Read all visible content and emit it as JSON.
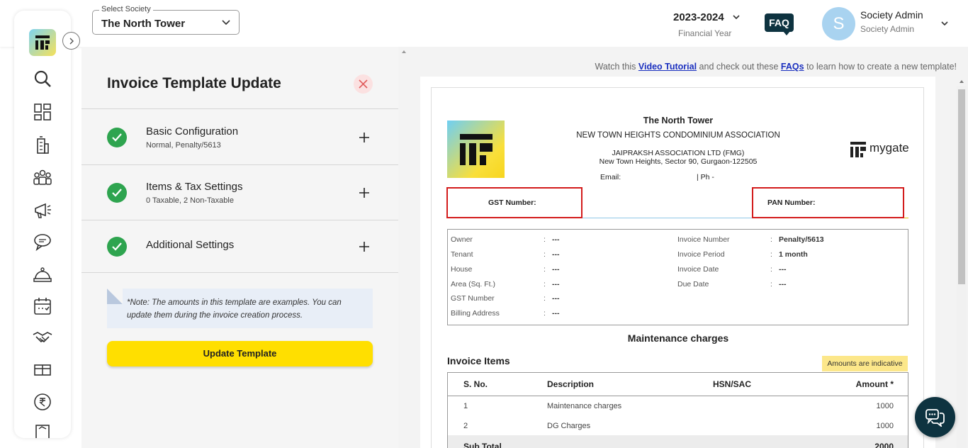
{
  "header": {
    "society_select_label": "Select Society",
    "society_select_value": "The North Tower",
    "financial_year": "2023-2024",
    "financial_year_label": "Financial Year",
    "faq_label": "FAQ",
    "avatar_initial": "S",
    "user_name": "Society Admin",
    "user_role": "Society Admin"
  },
  "sidebar": {
    "icons": [
      "mygate-logo-icon",
      "search-icon",
      "dashboard-icon",
      "building-icon",
      "residents-icon",
      "announcement-icon",
      "chat-icon",
      "helpdesk-icon",
      "calendar-icon",
      "handshake-icon",
      "amenities-icon",
      "rupee-icon"
    ]
  },
  "panel": {
    "title": "Invoice Template Update",
    "sections": [
      {
        "title": "Basic Configuration",
        "subtitle": "Normal, Penalty/5613"
      },
      {
        "title": "Items & Tax Settings",
        "subtitle": "0 Taxable, 2 Non-Taxable"
      },
      {
        "title": "Additional Settings",
        "subtitle": ""
      }
    ],
    "note": "*Note: The amounts in this template are examples. You can update them during the invoice creation process.",
    "update_button": "Update Template"
  },
  "tutorial": {
    "prefix": "Watch this",
    "video_link": "Video Tutorial",
    "middle": "and check out these",
    "faq_link": "FAQs",
    "suffix": "to learn how to create a new template!"
  },
  "invoice": {
    "society_name": "The North Tower",
    "association": "NEW TOWN HEIGHTS CONDOMINIUM ASSOCIATION",
    "address_line1": "JAIPRAKSH ASSOCIATION LTD (FMG)",
    "address_line2": "New Town Heights, Sector 90, Gurgaon-122505",
    "email_label": "Email:",
    "phone_label": "| Ph -",
    "brand": "mygate",
    "gst_label": "GST Number:",
    "pan_label": "PAN Number:",
    "left_fields": [
      {
        "key": "Owner",
        "value": "---"
      },
      {
        "key": "Tenant",
        "value": "---"
      },
      {
        "key": "House",
        "value": "---"
      },
      {
        "key": "Area (Sq. Ft.)",
        "value": "---"
      },
      {
        "key": "GST Number",
        "value": "---"
      },
      {
        "key": "Billing Address",
        "value": "---"
      }
    ],
    "right_fields": [
      {
        "key": "Invoice Number",
        "value": "Penalty/5613"
      },
      {
        "key": "Invoice Period",
        "value": "1 month"
      },
      {
        "key": "Invoice Date",
        "value": "---"
      },
      {
        "key": "Due Date",
        "value": "---"
      }
    ],
    "maintenance_title": "Maintenance charges",
    "items_title": "Invoice Items",
    "indicative_badge": "Amounts are indicative",
    "columns": {
      "sno": "S. No.",
      "description": "Description",
      "hsn": "HSN/SAC",
      "amount": "Amount *"
    },
    "items": [
      {
        "sno": "1",
        "description": "Maintenance charges",
        "amount": "1000"
      },
      {
        "sno": "2",
        "description": "DG Charges",
        "amount": "1000"
      }
    ],
    "subtotal_label": "Sub Total",
    "subtotal_value": "2000"
  },
  "colors": {
    "accent_yellow": "#ffdf00",
    "dark_navy": "#0e3340",
    "success_green": "#2ea44f",
    "highlight_red": "#d31c1c"
  }
}
